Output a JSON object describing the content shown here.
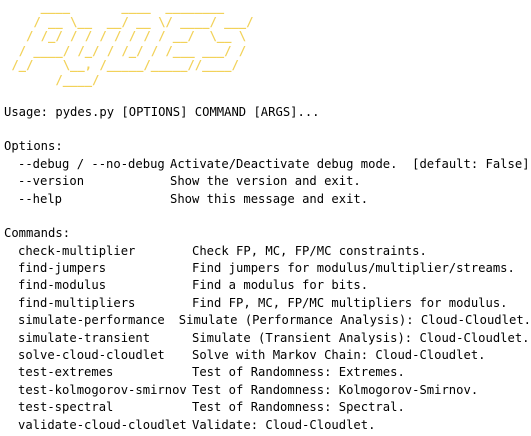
{
  "banner": {
    "color": "#f2d25a",
    "lines": [
      "     ____       ____  ________",
      "    / __ \\__  __/ __ \\/ ____/ ___/",
      "   / /_/ / / / / / / / __/  \\__ \\",
      "  / ____/ /_/ / /_/ / /___ ___/ /",
      " /_/    \\__, /_____/_____//____/",
      "       /____/"
    ]
  },
  "usage": "Usage: pydes.py [OPTIONS] COMMAND [ARGS]...",
  "options": {
    "heading": "Options:",
    "items": [
      {
        "name": "--debug / --no-debug",
        "desc": "Activate/Deactivate debug mode.  [default: False]"
      },
      {
        "name": "--version",
        "desc": "Show the version and exit."
      },
      {
        "name": "--help",
        "desc": "Show this message and exit."
      }
    ]
  },
  "commands": {
    "heading": "Commands:",
    "items": [
      {
        "name": "check-multiplier",
        "desc": "Check FP, MC, FP/MC constraints."
      },
      {
        "name": "find-jumpers",
        "desc": "Find jumpers for modulus/multiplier/streams."
      },
      {
        "name": "find-modulus",
        "desc": "Find a modulus for bits."
      },
      {
        "name": "find-multipliers",
        "desc": "Find FP, MC, FP/MC multipliers for modulus."
      },
      {
        "name": "simulate-performance",
        "desc": "Simulate (Performance Analysis): Cloud-Cloudlet."
      },
      {
        "name": "simulate-transient",
        "desc": "Simulate (Transient Analysis): Cloud-Cloudlet."
      },
      {
        "name": "solve-cloud-cloudlet",
        "desc": "Solve with Markov Chain: Cloud-Cloudlet."
      },
      {
        "name": "test-extremes",
        "desc": "Test of Randomness: Extremes."
      },
      {
        "name": "test-kolmogorov-smirnov",
        "desc": "Test of Randomness: Kolmogorov-Smirnov."
      },
      {
        "name": "test-spectral",
        "desc": "Test of Randomness: Spectral."
      },
      {
        "name": "validate-cloud-cloudlet",
        "desc": "Validate: Cloud-Cloudlet."
      }
    ]
  }
}
